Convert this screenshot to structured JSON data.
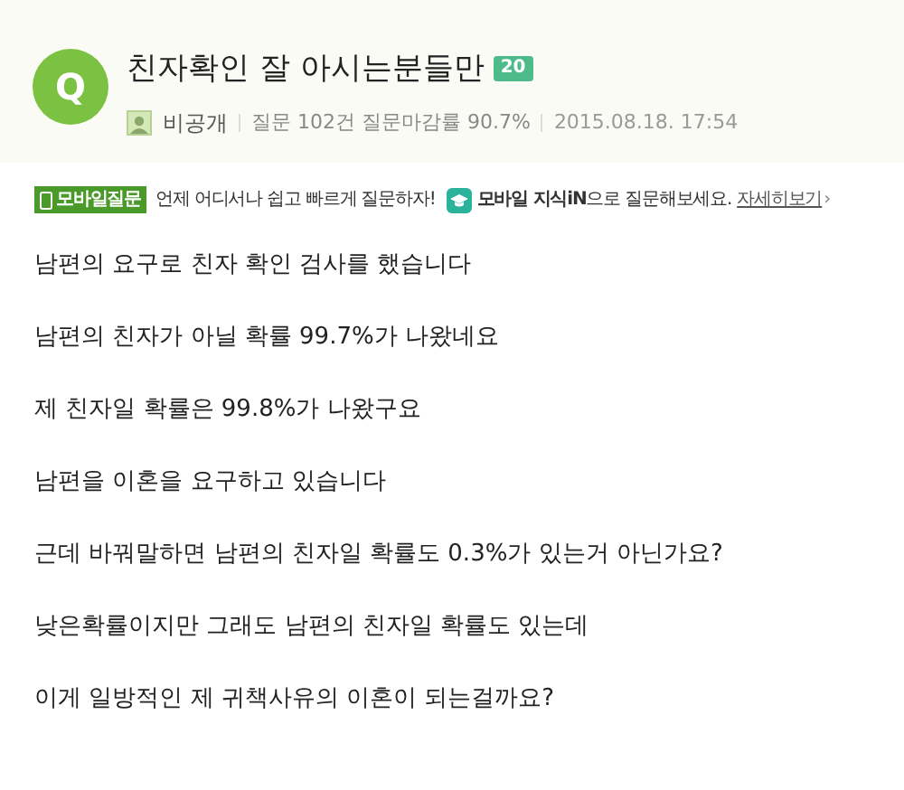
{
  "question": {
    "badge": "Q",
    "title": "친자확인 잘 아시는분들만",
    "points": "20",
    "author": "비공개",
    "stats": "질문 102건 질문마감률 90.7%",
    "date": "2015.08.18. 17:54"
  },
  "mobile_banner": {
    "tag": "모바일질문",
    "slogan": "언제 어디서나 쉽고 빠르게 질문하자!",
    "message": "**모바일 지식iN**으로 질문해보세요.",
    "link": "자세히보기",
    "link_arrow": "›"
  },
  "body": [
    "남편의 요구로 친자 확인 검사를 했습니다",
    "남편의 친자가 아닐 확률 99.7%가 나왔네요",
    "제 친자일 확률은 99.8%가 나왔구요",
    "남편을 이혼을 요구하고 있습니다",
    "근데 바꿔말하면 남편의 친자일 확률도 0.3%가 있는거 아닌가요?",
    "낮은확률이지만 그래도 남편의 친자일 확률도 있는데",
    "이게 일방적인 제 귀책사유의 이혼이 되는걸까요?"
  ]
}
